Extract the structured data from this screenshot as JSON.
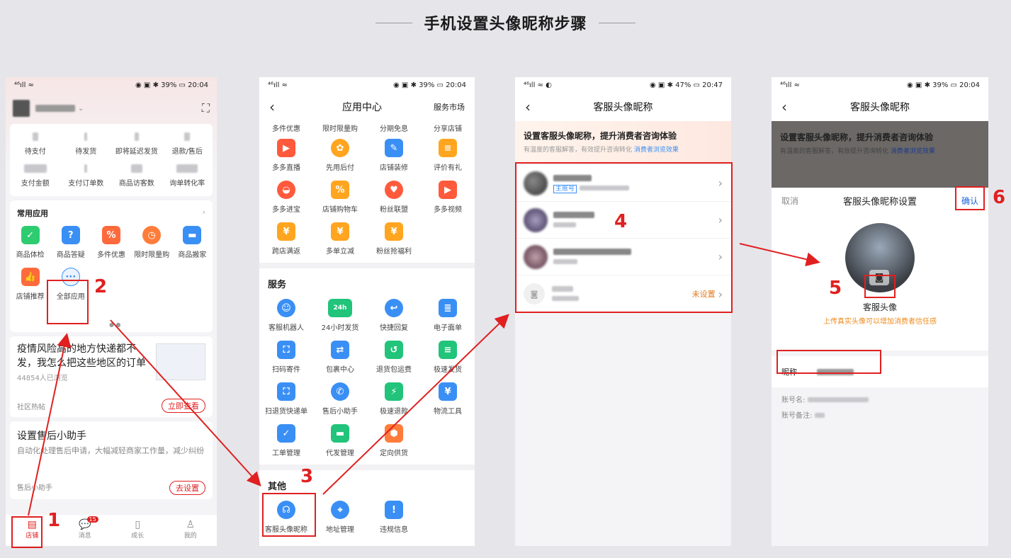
{
  "page": {
    "title": "手机设置头像昵称步骤"
  },
  "steps": [
    "1",
    "2",
    "3",
    "4",
    "5",
    "6"
  ],
  "p1": {
    "status_time": "20:04",
    "status_battery": "39%",
    "stats_row1": [
      "待支付",
      "待发货",
      "即将延迟发货",
      "退款/售后"
    ],
    "stats_row2": [
      "支付金额",
      "支付订单数",
      "商品访客数",
      "询单转化率"
    ],
    "apps_title": "常用应用",
    "apps": [
      "商品体检",
      "商品答疑",
      "多件优惠",
      "限时限量购",
      "商品搬家"
    ],
    "apps2": [
      "店铺推荐",
      "全部应用"
    ],
    "article1": {
      "title": "疫情风险高的地方快递都不发，我怎么把这些地区的订单",
      "meta": "44854人已浏览",
      "source": "社区热帖",
      "btn": "立即查看"
    },
    "article2": {
      "title": "设置售后小助手",
      "desc": "自动化处理售后申请，大幅减轻商家工作量，减少纠纷",
      "source": "售后小助手",
      "btn": "去设置"
    },
    "tabbar": [
      "店铺",
      "消息",
      "成长",
      "我的"
    ],
    "msg_badge": "15"
  },
  "p2": {
    "status_time": "20:04",
    "status_battery": "39%",
    "nav_title": "应用中心",
    "nav_right": "服务市场",
    "top_row": [
      "多件优惠",
      "限时限量购",
      "分期免息",
      "分享店铺"
    ],
    "grid_a": [
      "多多直播",
      "先用后付",
      "店铺装修",
      "评价有礼"
    ],
    "grid_b": [
      "多多进宝",
      "店铺购物车",
      "粉丝联盟",
      "多多视频"
    ],
    "grid_c": [
      "跨店满返",
      "多单立减",
      "粉丝抢福利"
    ],
    "service_title": "服务",
    "svc_a": [
      "客服机器人",
      "24小时发货",
      "快捷回复",
      "电子面单"
    ],
    "svc_b": [
      "扫码寄件",
      "包裹中心",
      "退货包运费",
      "极速发货"
    ],
    "svc_c": [
      "扫退货快递单",
      "售后小助手",
      "极速退款",
      "物流工具"
    ],
    "svc_d": [
      "工单管理",
      "代发管理",
      "定向供货"
    ],
    "other_title": "其他",
    "other": [
      "客服头像昵称",
      "地址管理",
      "违规信息"
    ]
  },
  "p3": {
    "status_time": "20:47",
    "status_battery": "47%",
    "nav_title": "客服头像昵称",
    "banner_title": "设置客服头像昵称，提升消费者咨询体验",
    "banner_sub": "有温度的客服解答，有效提升咨询转化",
    "banner_link": "消费者浏览效果",
    "main_tag": "主账号",
    "unset": "未设置"
  },
  "p4": {
    "status_time": "20:04",
    "status_battery": "39%",
    "nav_title": "客服头像昵称",
    "banner_title": "设置客服头像昵称，提升消费者咨询体验",
    "banner_sub": "有温度的客服解答，有效提升咨询转化",
    "banner_link": "消费者浏览效果",
    "cancel": "取消",
    "sheet_title": "客服头像昵称设置",
    "confirm": "确认",
    "avatar_label": "客服头像",
    "avatar_hint": "上传真实头像可以增加消费者信任感",
    "nick_label": "昵称",
    "acct_label": "账号名:",
    "acct_note": "账号备注:"
  }
}
